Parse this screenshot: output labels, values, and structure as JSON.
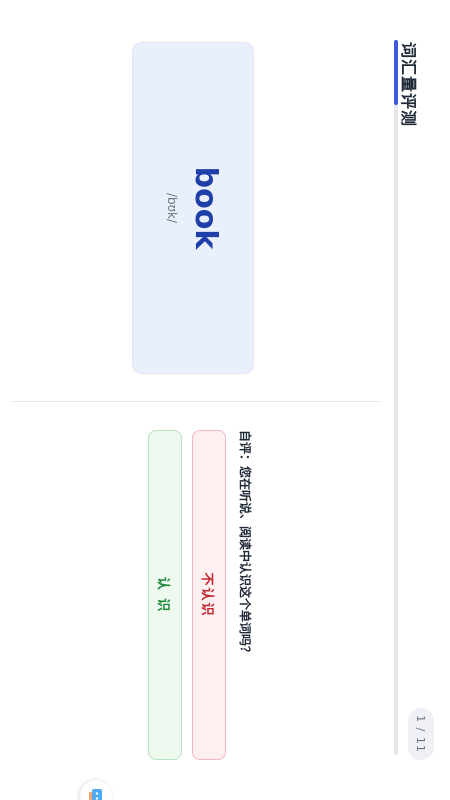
{
  "header": {
    "title": "词汇量评测",
    "counter": "1 / 11",
    "progress": 0.0909
  },
  "card": {
    "word": "book",
    "phonetic": "/bʊk/"
  },
  "prompt": {
    "text": "自评：您在听说、阅读中认识这个单词吗？"
  },
  "buttons": {
    "unknown_label": "不认识",
    "known_label": "认 识"
  },
  "colors": {
    "accent": "#3b5bdb",
    "word": "#1e3fa8",
    "unknown": "#c0262d",
    "known": "#1f8a3b"
  },
  "icons": {
    "fab": "assistant-icon"
  }
}
